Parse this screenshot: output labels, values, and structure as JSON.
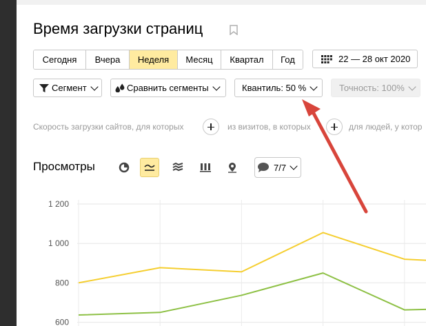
{
  "page": {
    "title": "Время загрузки страниц"
  },
  "periods": {
    "items": [
      "Сегодня",
      "Вчера",
      "Неделя",
      "Месяц",
      "Квартал",
      "Год"
    ],
    "active_index": 2,
    "date_range": "22 — 28 окт 2020"
  },
  "filters": {
    "segment_label": "Сегмент",
    "compare_label": "Сравнить сегменты",
    "quantile_label": "Квантиль: 50 %",
    "precision_label": "Точность: 100%"
  },
  "description": {
    "part1": "Скорость загрузки сайтов, для которых",
    "part2": "из визитов, в которых",
    "part3": "для людей, у котор"
  },
  "metric": {
    "title": "Просмотры",
    "series_counter": "7/7"
  },
  "colors": {
    "accent": "#ffeba0",
    "series_yellow": "#f5ce2f",
    "series_green": "#8dc044",
    "arrow": "#d8453b"
  },
  "chart_data": {
    "type": "line",
    "x": [
      0,
      1,
      2,
      3,
      4,
      5
    ],
    "ylim": [
      600,
      1200
    ],
    "yticks": [
      1200,
      1000,
      800,
      600
    ],
    "ytick_labels": [
      "1 200",
      "1 000",
      "800",
      "600"
    ],
    "series": [
      {
        "color": "#f5ce2f",
        "values": [
          800,
          877,
          856,
          1055,
          920,
          900
        ]
      },
      {
        "color": "#8dc044",
        "values": [
          637,
          650,
          737,
          850,
          663,
          672
        ]
      }
    ]
  }
}
